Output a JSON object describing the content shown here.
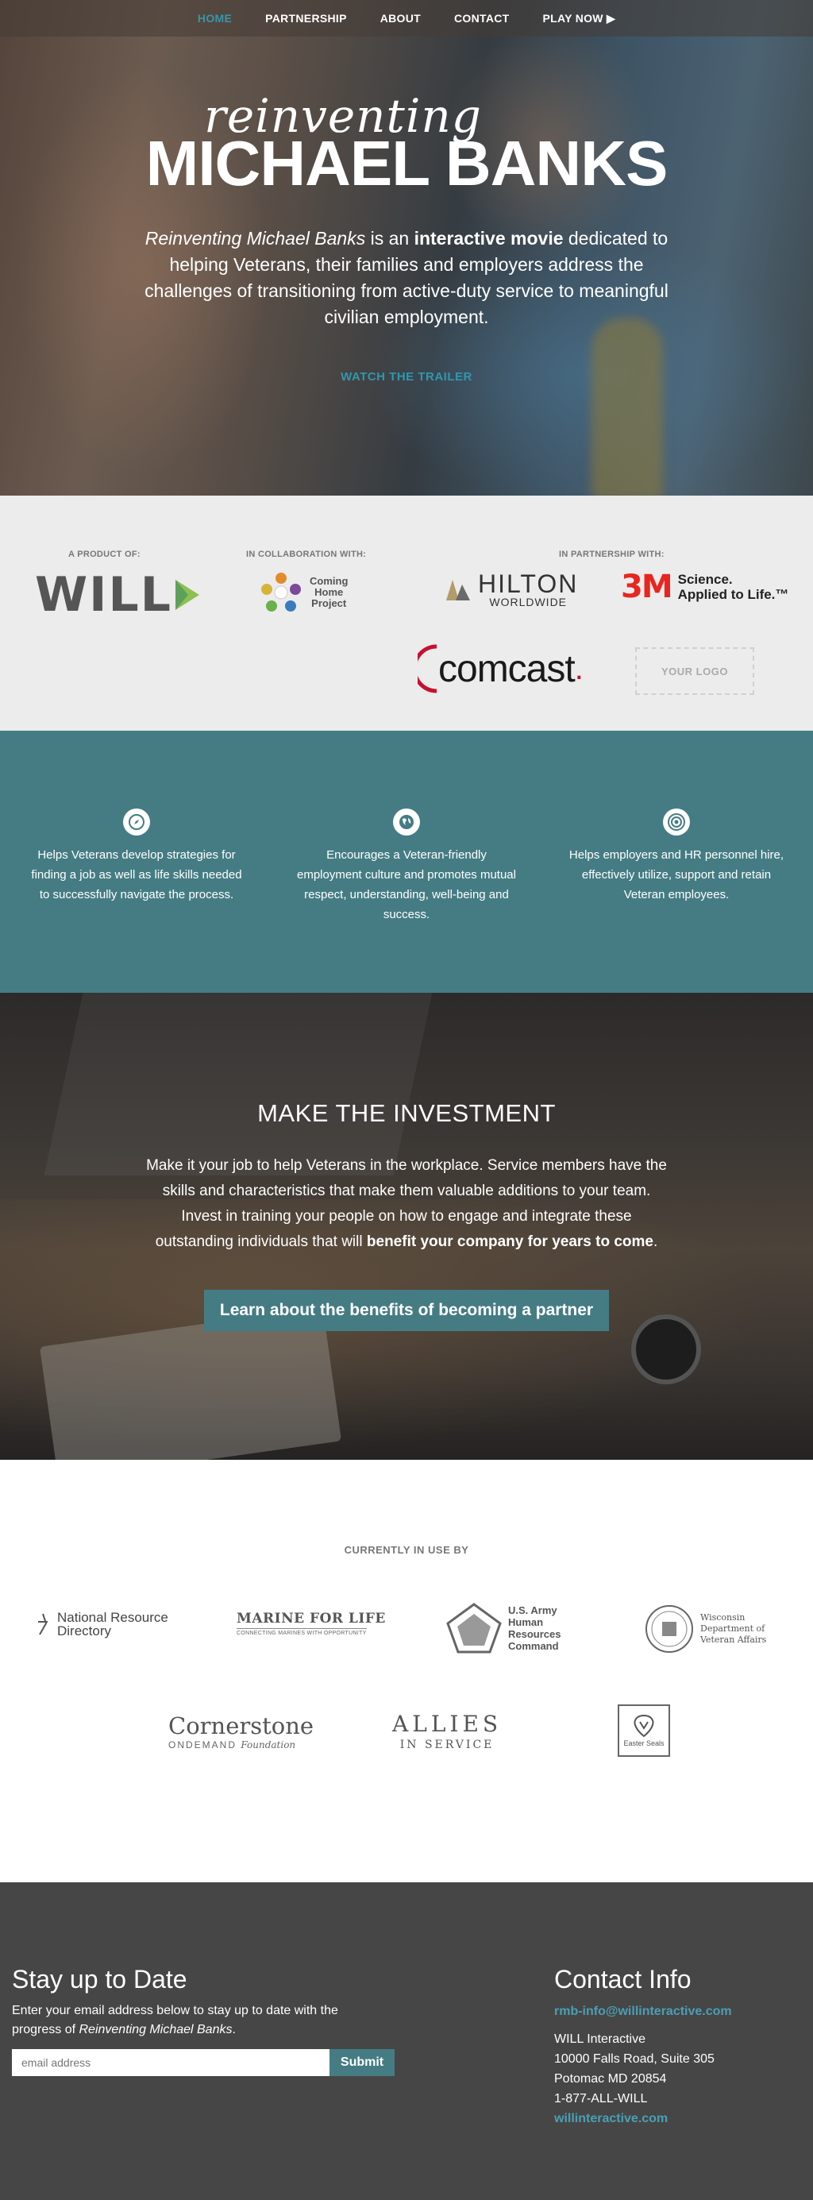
{
  "nav": {
    "items": [
      {
        "label": "HOME",
        "active": true
      },
      {
        "label": "PARTNERSHIP"
      },
      {
        "label": "ABOUT"
      },
      {
        "label": "CONTACT"
      },
      {
        "label": "PLAY NOW ▶"
      }
    ]
  },
  "hero": {
    "logo_script": "reinventing",
    "logo_main": "MICHAEL BANKS",
    "desc_title": "Reinventing Michael Banks",
    "desc_is_an": " is an ",
    "desc_bold": "interactive movie",
    "desc_rest": " dedicated to helping Veterans, their families and employers address the challenges of transitioning from active-duty service to meaningful civilian employment.",
    "trailer_label": "WATCH THE TRAILER"
  },
  "partners": {
    "product_label": "A PRODUCT OF:",
    "collab_label": "IN COLLABORATION WITH:",
    "partnership_label": "IN PARTNERSHIP WITH:",
    "will": "WILL",
    "chp_line1": "Coming",
    "chp_line2": "Home",
    "chp_line3": "Project",
    "hilton_main": "HILTON",
    "hilton_sub": "WORLDWIDE",
    "threem_logo": "3M",
    "threem_tag1": "Science.",
    "threem_tag2": "Applied to Life.™",
    "comcast": "comcast",
    "comcast_mark": ".",
    "your_logo": "YOUR LOGO"
  },
  "features": [
    {
      "icon": "compass-icon",
      "text": "Helps Veterans develop strategies for finding a job as well as life skills needed to successfully navigate the process."
    },
    {
      "icon": "globe-icon",
      "text": "Encourages a Veteran-friendly employment culture and promotes mutual respect, understanding, well-being and success."
    },
    {
      "icon": "target-icon",
      "text": "Helps employers and HR personnel hire, effectively utilize, support and retain Veteran employees."
    }
  ],
  "invest": {
    "title": "MAKE THE INVESTMENT",
    "text": "Make it your job to help Veterans in the workplace. Service members have the skills and characteristics that make them valuable additions to your team. Invest in training your people on how to engage and integrate these outstanding individuals that will ",
    "text_bold": "benefit your company for years to come",
    "text_end": ".",
    "button": "Learn about the benefits of becoming a partner"
  },
  "inuse": {
    "title": "CURRENTLY IN USE BY",
    "nrd_line1": "National Resource",
    "nrd_line2": "Directory",
    "mfl_main": "MARINE FOR LIFE",
    "mfl_sub": "CONNECTING MARINES WITH OPPORTUNITY",
    "army_l1": "U.S. Army",
    "army_l2": "Human",
    "army_l3": "Resources",
    "army_l4": "Command",
    "wdva_l1": "Wisconsin",
    "wdva_l2": "Department of",
    "wdva_l3": "Veteran Affairs",
    "corner_main": "Cornerstone",
    "corner_sub": "ONDEMAND",
    "corner_found": "Foundation",
    "allies_l1": "ALLIES",
    "allies_l2": "IN SERVICE",
    "easter_l1": "Easter Seals"
  },
  "footer": {
    "stay_title": "Stay up to Date",
    "stay_text_pre": "Enter your email address below to stay up to date with the progress of ",
    "stay_text_italic": "Reinventing Michael Banks",
    "stay_text_post": ".",
    "email_placeholder": "email address",
    "submit": "Submit",
    "contact_title": "Contact Info",
    "contact_email": "rmb-info@willinteractive.com",
    "company": "WILL Interactive",
    "address1": "10000 Falls Road, Suite 305",
    "address2": "Potomac MD 20854",
    "phone": "1-877-ALL-WILL",
    "website": "willinteractive.com"
  }
}
